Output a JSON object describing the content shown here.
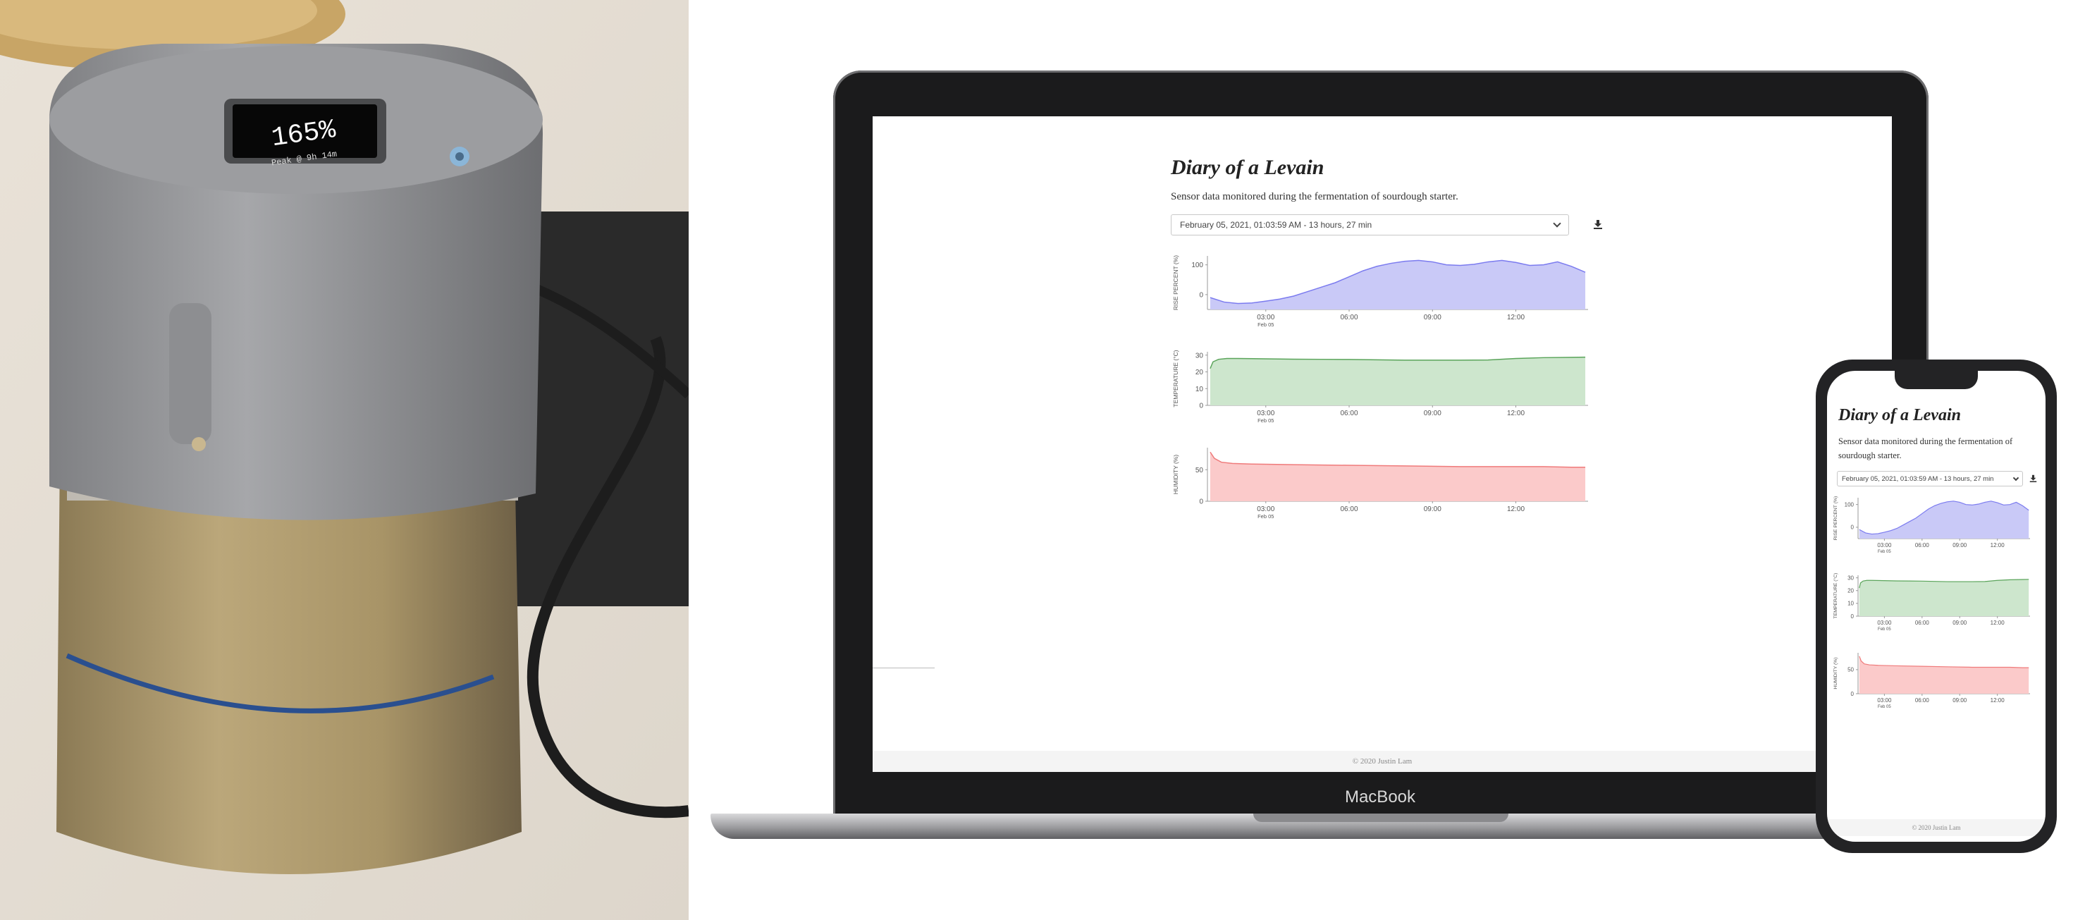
{
  "photo": {
    "oled_reading": "165%",
    "oled_sub": "Peak @ 9h 14m"
  },
  "laptop": {
    "brand": "MacBook"
  },
  "app": {
    "title": "Diary of a Levain",
    "subtitle": "Sensor data monitored during the fermentation of sourdough starter.",
    "session_select": "February 05, 2021, 01:03:59 AM - 13 hours, 27 min",
    "download_icon": "download-icon",
    "footer": "© 2020 Justin Lam",
    "colors": {
      "rise": "#7b7bef",
      "rise_fill": "#c9c9f7",
      "temperature": "#5aa45a",
      "temperature_fill": "#cde6cd",
      "humidity": "#ef7b7b",
      "humidity_fill": "#fbcaca"
    }
  },
  "chart_data": [
    {
      "type": "area",
      "ylabel": "RISE PERCENT (%)",
      "yticks": [
        0,
        100
      ],
      "ylim": [
        -50,
        130
      ],
      "x_ticks": [
        "03:00",
        "06:00",
        "09:00",
        "12:00"
      ],
      "x_sublabel": "Feb 05",
      "x": [
        1.0,
        1.5,
        2.0,
        2.5,
        3.0,
        3.5,
        4.0,
        4.5,
        5.0,
        5.5,
        6.0,
        6.5,
        7.0,
        7.5,
        8.0,
        8.5,
        9.0,
        9.5,
        10.0,
        10.5,
        11.0,
        11.5,
        12.0,
        12.5,
        13.0,
        13.5,
        14.0,
        14.5
      ],
      "values": [
        -10,
        -25,
        -30,
        -28,
        -22,
        -15,
        -5,
        10,
        25,
        40,
        60,
        80,
        95,
        105,
        112,
        115,
        110,
        100,
        98,
        102,
        110,
        115,
        108,
        98,
        100,
        110,
        95,
        75
      ]
    },
    {
      "type": "area",
      "ylabel": "TEMPERATURE (°C)",
      "yticks": [
        0,
        10,
        20,
        30
      ],
      "ylim": [
        0,
        32
      ],
      "x_ticks": [
        "03:00",
        "06:00",
        "09:00",
        "12:00"
      ],
      "x_sublabel": "Feb 05",
      "x": [
        1.0,
        1.1,
        1.3,
        1.6,
        2.0,
        3.0,
        4.0,
        5.0,
        6.0,
        7.0,
        8.0,
        9.0,
        10.0,
        11.0,
        12.0,
        13.0,
        14.0,
        14.5
      ],
      "values": [
        22,
        26,
        27.5,
        28,
        28,
        27.8,
        27.6,
        27.5,
        27.4,
        27.2,
        27.0,
        27.0,
        27.0,
        27.1,
        28,
        28.5,
        28.7,
        28.8
      ]
    },
    {
      "type": "area",
      "ylabel": "HUMIDITY (%)",
      "yticks": [
        0,
        50
      ],
      "ylim": [
        0,
        85
      ],
      "x_ticks": [
        "03:00",
        "06:00",
        "09:00",
        "12:00"
      ],
      "x_sublabel": "Feb 05",
      "x": [
        1.0,
        1.15,
        1.4,
        1.8,
        2.5,
        4.0,
        6.0,
        8.0,
        10.0,
        12.0,
        13.0,
        14.0,
        14.5
      ],
      "values": [
        78,
        68,
        62,
        60,
        59,
        58,
        57,
        56,
        55,
        55,
        55,
        54,
        54
      ]
    }
  ]
}
